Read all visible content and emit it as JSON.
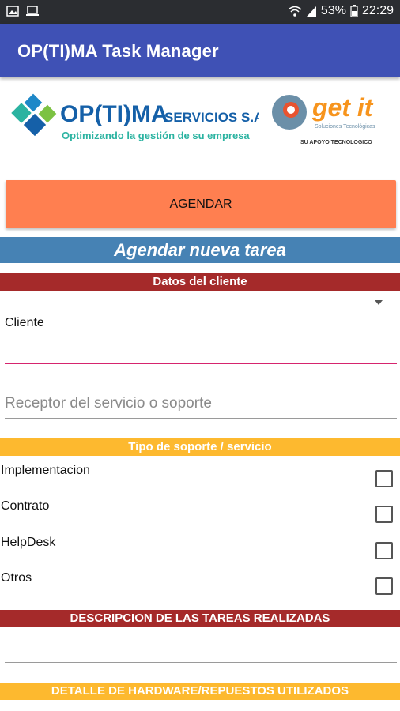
{
  "statusbar": {
    "battery": "53%",
    "time": "22:29",
    "left_icons": [
      "image-icon",
      "laptop-icon"
    ],
    "right_icons": [
      "wifi-icon",
      "signal-icon",
      "battery-icon"
    ]
  },
  "app": {
    "title": "OP(TI)MA Task Manager",
    "bar_color": "#3f51b5"
  },
  "logos": {
    "optima": {
      "name": "OP(TI)MA",
      "suffix": "SERVICIOS S.A.",
      "tagline": "Optimizando la gestión de su empresa"
    },
    "getit": {
      "name": "get it",
      "sub": "Soluciones Tecnológicas",
      "support": "SU APOYO TECNOLOGICO"
    }
  },
  "actions": {
    "agendar_label": "AGENDAR",
    "agendar_color": "#ff7f50"
  },
  "form": {
    "title": "Agendar nueva tarea",
    "client_section": "Datos del cliente",
    "client_label": "Cliente",
    "receptor_placeholder": "Receptor del servicio o soporte",
    "support_section": "Tipo de soporte / servicio",
    "support_options": [
      "Implementacion",
      "Contrato",
      "HelpDesk",
      "Otros"
    ],
    "tasks_section": "DESCRIPCION DE LAS TAREAS REALIZADAS",
    "hardware_section": "DETALLE DE HARDWARE/REPUESTOS UTILIZADOS"
  },
  "colors": {
    "section_blue": "#4682b4",
    "band_red": "#a52a2a",
    "band_gold": "#fdb92f",
    "underline_pink": "#d6246e"
  }
}
